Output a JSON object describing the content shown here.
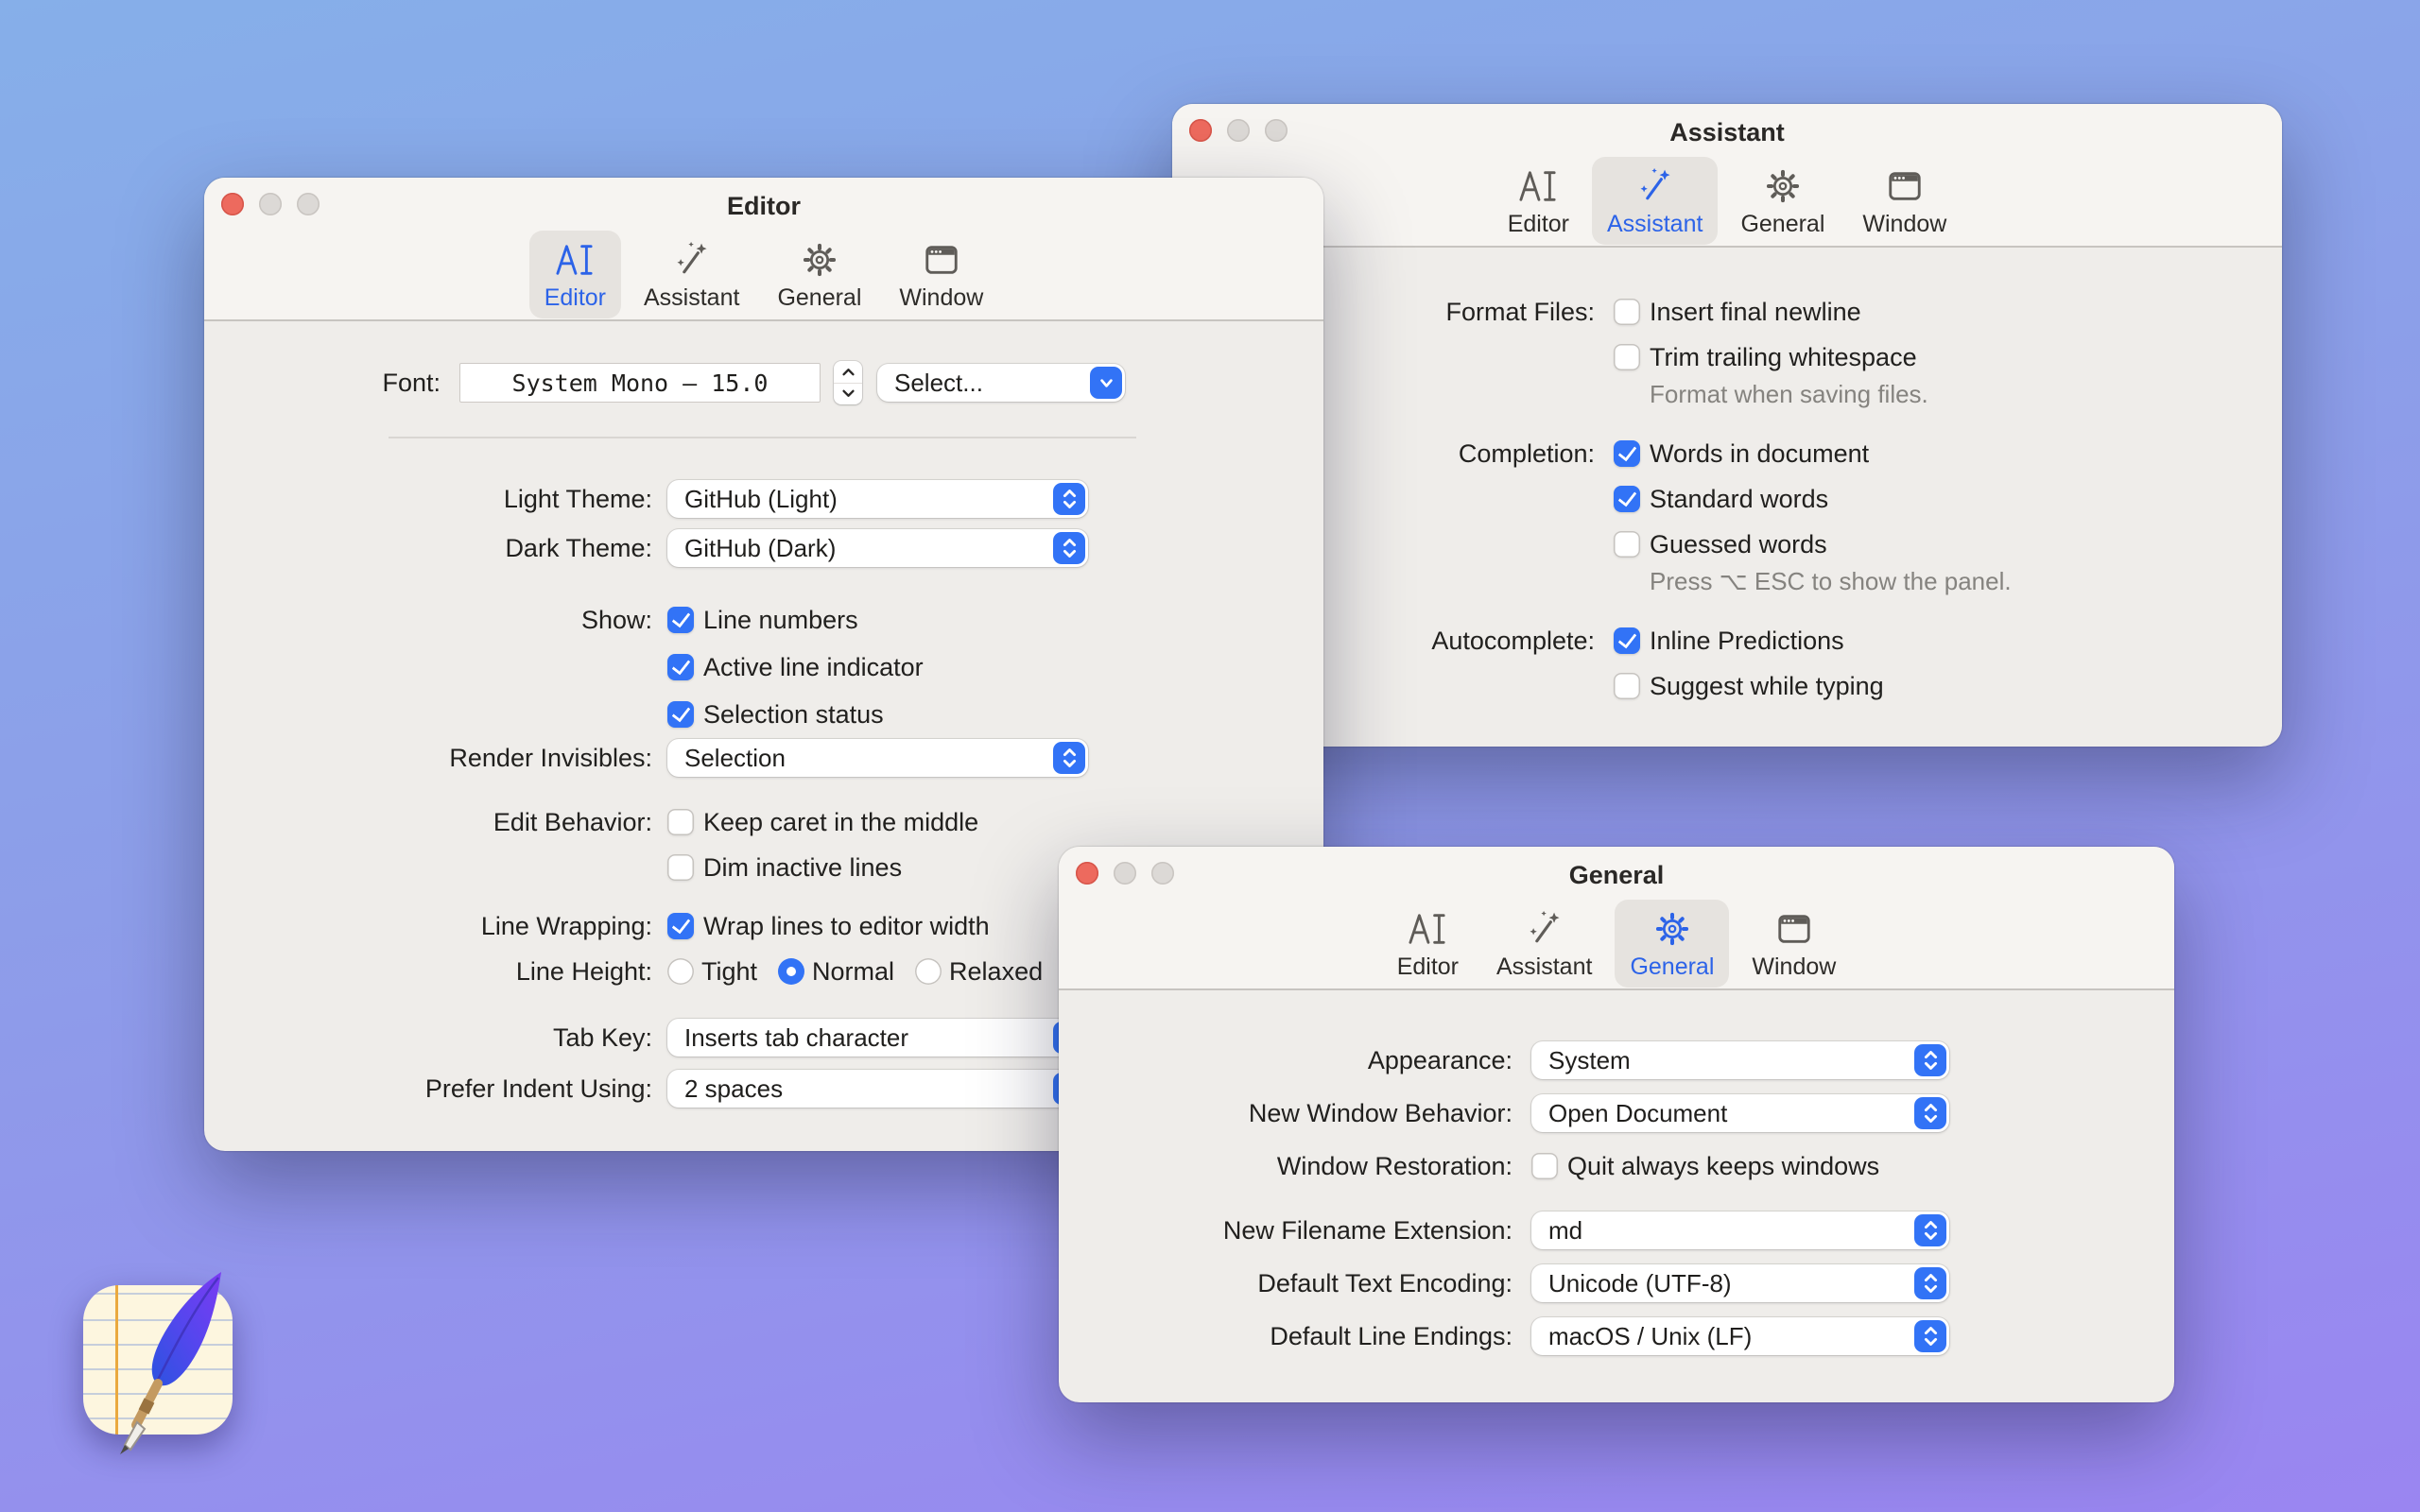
{
  "background": {
    "top_color": "#86afe9",
    "bottom_color": "#9a85f1"
  },
  "accent_blue": "#3273f6",
  "tabs": [
    {
      "label": "Editor"
    },
    {
      "label": "Assistant"
    },
    {
      "label": "General"
    },
    {
      "label": "Window"
    }
  ],
  "editor_window": {
    "title": "Editor",
    "selected_tab_index": 0,
    "font": {
      "label": "Font:",
      "value": "System Mono — 15.0",
      "select_label": "Select..."
    },
    "light_theme": {
      "label": "Light Theme:",
      "value": "GitHub (Light)"
    },
    "dark_theme": {
      "label": "Dark Theme:",
      "value": "GitHub (Dark)"
    },
    "show": {
      "label": "Show:",
      "items": [
        {
          "label": "Line numbers",
          "checked": true
        },
        {
          "label": "Active line indicator",
          "checked": true
        },
        {
          "label": "Selection status",
          "checked": true
        }
      ]
    },
    "render_invisibles": {
      "label": "Render Invisibles:",
      "value": "Selection"
    },
    "edit_behavior": {
      "label": "Edit Behavior:",
      "items": [
        {
          "label": "Keep caret in the middle",
          "checked": false
        },
        {
          "label": "Dim inactive lines",
          "checked": false
        }
      ]
    },
    "line_wrapping": {
      "label": "Line Wrapping:",
      "items": [
        {
          "label": "Wrap lines to editor width",
          "checked": true
        }
      ]
    },
    "line_height": {
      "label": "Line Height:",
      "options": [
        {
          "label": "Tight",
          "selected": false
        },
        {
          "label": "Normal",
          "selected": true
        },
        {
          "label": "Relaxed",
          "selected": false
        }
      ]
    },
    "tab_key": {
      "label": "Tab Key:",
      "value": "Inserts tab character"
    },
    "prefer_indent": {
      "label": "Prefer Indent Using:",
      "value": "2 spaces"
    }
  },
  "assistant_window": {
    "title": "Assistant",
    "selected_tab_index": 1,
    "format_files": {
      "label": "Format Files:",
      "items": [
        {
          "label": "Insert final newline",
          "checked": false
        },
        {
          "label": "Trim trailing whitespace",
          "checked": false
        }
      ],
      "caption": "Format when saving files."
    },
    "completion": {
      "label": "Completion:",
      "items": [
        {
          "label": "Words in document",
          "checked": true
        },
        {
          "label": "Standard words",
          "checked": true
        },
        {
          "label": "Guessed words",
          "checked": false
        }
      ],
      "caption": "Press ⌥ ESC to show the panel."
    },
    "autocomplete": {
      "label": "Autocomplete:",
      "items": [
        {
          "label": "Inline Predictions",
          "checked": true
        },
        {
          "label": "Suggest while typing",
          "checked": false
        }
      ]
    }
  },
  "general_window": {
    "title": "General",
    "selected_tab_index": 2,
    "appearance": {
      "label": "Appearance:",
      "value": "System"
    },
    "new_window_behavior": {
      "label": "New Window Behavior:",
      "value": "Open Document"
    },
    "window_restoration": {
      "label": "Window Restoration:",
      "items": [
        {
          "label": "Quit always keeps windows",
          "checked": false
        }
      ]
    },
    "new_filename_extension": {
      "label": "New Filename Extension:",
      "value": "md"
    },
    "default_text_encoding": {
      "label": "Default Text Encoding:",
      "value": "Unicode (UTF-8)"
    },
    "default_line_endings": {
      "label": "Default Line Endings:",
      "value": "macOS / Unix (LF)"
    }
  },
  "app_icon": {
    "name": "paper-writing-app-icon"
  }
}
